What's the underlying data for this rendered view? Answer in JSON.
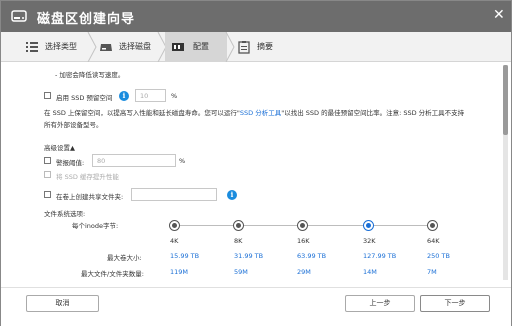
{
  "window": {
    "title": "磁盘区创建向导",
    "close_glyph": "✕"
  },
  "steps": [
    {
      "label": "选择类型",
      "icon": "list-icon"
    },
    {
      "label": "选择磁盘",
      "icon": "disk-icon"
    },
    {
      "label": "配置",
      "icon": "config-icon"
    },
    {
      "label": "摘要",
      "icon": "clipboard-icon"
    }
  ],
  "content": {
    "encrypt_note": "- 加密会降低读写速度。",
    "ssd_reserve": {
      "label": "启用 SSD 预留空间",
      "value": "10",
      "unit": "%",
      "desc_1_pre": "在 SSD 上保留空间，以提高写入性能和延长磁盘寿命。您可以运行\"",
      "desc_1_link": "SSD 分析工具",
      "desc_1_post": "\"以找出 SSD 的最佳预留空间比率。注意: SSD 分析工具不支持",
      "desc_2": "所有外部设备型号。"
    },
    "advanced": {
      "title": "高级设置▲",
      "alert_label": "警报阈值:",
      "alert_value": "80",
      "alert_unit": "%",
      "ssd_cache_label": "将 SSD 缓存提升性能",
      "shared_folder_label": "在卷上创建共享文件夹:",
      "fs_options_label": "文件系统选项:",
      "inode_label": "每个inode字节:",
      "max_volume_label": "最大卷大小:",
      "max_files_label": "最大文件/文件夹数量:",
      "inode_options": [
        {
          "size": "4K",
          "max_volume": "15.99 TB",
          "max_files": "119M",
          "selected": false
        },
        {
          "size": "8K",
          "max_volume": "31.99 TB",
          "max_files": "59M",
          "selected": false
        },
        {
          "size": "16K",
          "max_volume": "63.99 TB",
          "max_files": "29M",
          "selected": false
        },
        {
          "size": "32K",
          "max_volume": "127.99 TB",
          "max_files": "14M",
          "selected": true
        },
        {
          "size": "64K",
          "max_volume": "250 TB",
          "max_files": "7M",
          "selected": false
        }
      ]
    }
  },
  "footer": {
    "cancel": "取消",
    "back": "上一步",
    "next": "下一步"
  },
  "colors": {
    "titlebar": "#6d6d6d",
    "accent": "#1a6fd6",
    "info": "#1a8cde"
  }
}
